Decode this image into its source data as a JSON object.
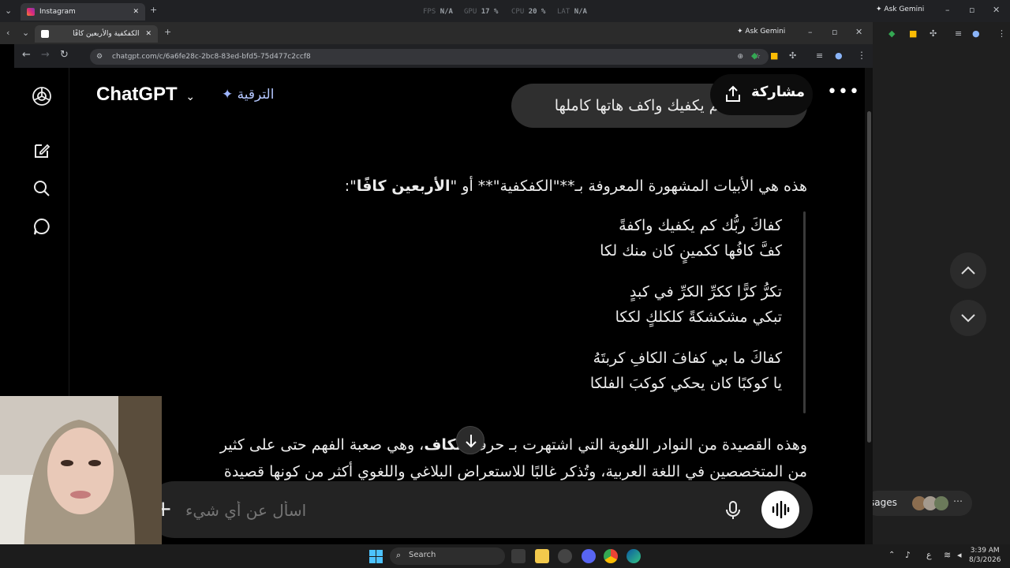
{
  "back_browser": {
    "tab_title": "Instagram",
    "ask_gemini": "Ask Gemini",
    "stats": [
      {
        "label": "FPS",
        "value": "N/A"
      },
      {
        "label": "GPU",
        "value": "17 %"
      },
      {
        "label": "CPU",
        "value": "20 %"
      },
      {
        "label": "LAT",
        "value": "N/A"
      }
    ]
  },
  "front_browser": {
    "tab_title": "الكفكفية والأربعين كافًا",
    "ask_gemini": "Ask Gemini",
    "url": "chatgpt.com/c/6a6fe28c-2bc8-83ed-bfd5-75d477c2ccf8"
  },
  "header": {
    "model_name": "ChatGPT",
    "upgrade_label": "الترقية",
    "share_label": "مشاركة"
  },
  "user_message": "كفاك ربك كم يكفيك واكف هاتها كاملها",
  "assistant": {
    "intro_1": "هذه هي الأبيات المشهورة المعروفة بـ**\"الكفكفية\"** أو \"",
    "intro_bold": "الأربعين كافًا",
    "intro_2": "\":",
    "verses": [
      "كفاكَ ربُّك كم يكفيك واكفةً",
      "كفَّ كافُها ككمينٍ كان منك لكا",
      "تكرُّ كرًّا ككرِّ الكرِّ في كبدٍ",
      "تبكي مشكشكةً كلكلكٍ لككا",
      "كفاكَ ما بي كفافَ الكافِ كربتَهُ",
      "يا كوكبًا كان يحكي كوكبَ الفلكا"
    ],
    "para_line1_a": "وهذه القصيدة من النوادر اللغوية التي اشتهرت بـ",
    "para_line1_b": " حرف ",
    "para_line1_bold": "الكاف",
    "para_line1_c": "، وهي صعبة الفهم حتى على كثير",
    "para_line2": "من المتخصصين في اللغة العربية، وتُذكر غالبًا للاستعراض البلاغي واللغوي أكثر من كونها قصيدة"
  },
  "composer": {
    "placeholder": "اسأل عن أي شيء"
  },
  "side_panel": {
    "messages_label": "sages"
  },
  "taskbar": {
    "search_label": "Search",
    "time": "3:39 AM",
    "date": "8/3/2026",
    "lang": "ع"
  }
}
